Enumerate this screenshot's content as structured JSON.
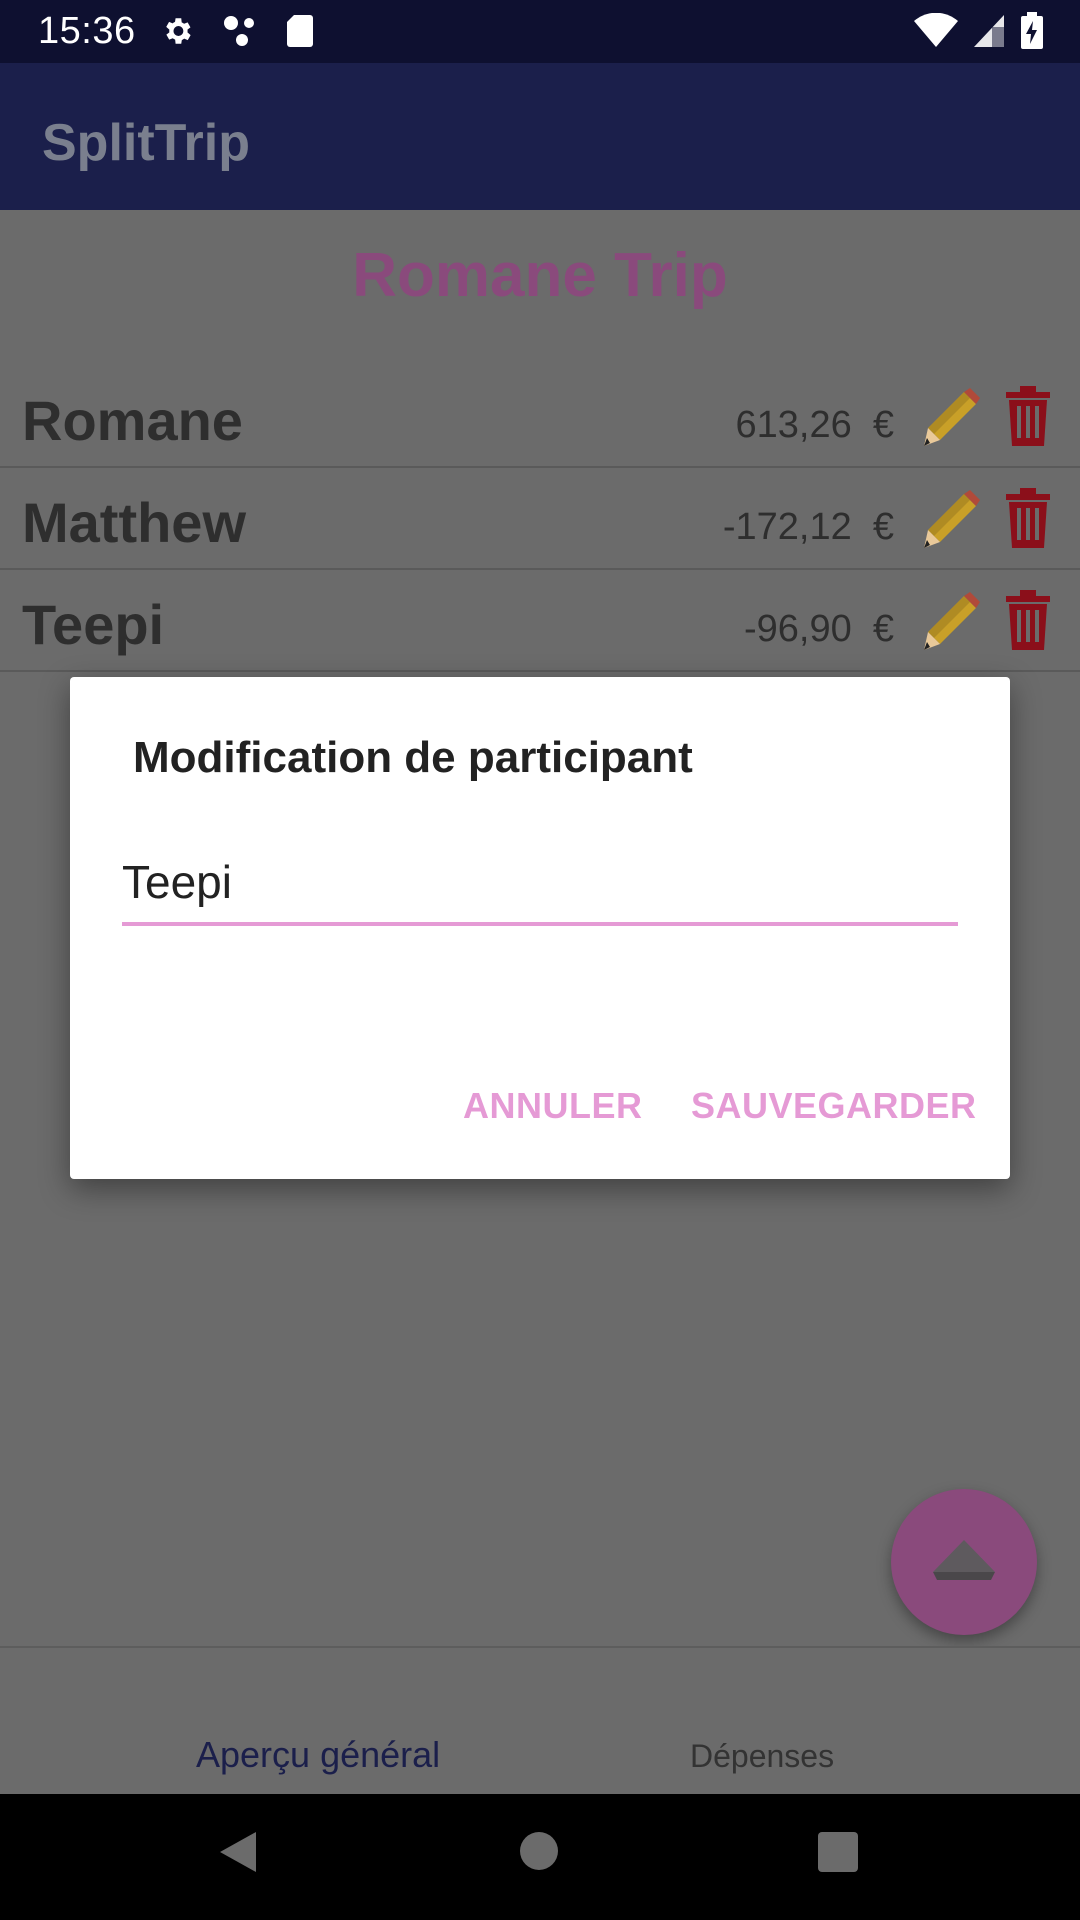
{
  "status": {
    "time": "15:36"
  },
  "app": {
    "title": "SplitTrip"
  },
  "trip": {
    "title": "Romane Trip"
  },
  "participants": [
    {
      "name": "Romane",
      "amount": "613,26",
      "currency": "€"
    },
    {
      "name": "Matthew",
      "amount": "-172,12",
      "currency": "€"
    },
    {
      "name": "Teepi",
      "amount": "-96,90",
      "currency": "€"
    }
  ],
  "dialog": {
    "title": "Modification de participant",
    "input_value": "Teepi",
    "cancel_label": "ANNULER",
    "save_label": "SAUVEGARDER"
  },
  "tabs": {
    "apercu": "Aperçu général",
    "depenses": "Dépenses"
  },
  "colors": {
    "accent": "#e59ad5",
    "appbar": "#1b1f4b",
    "delete": "#8b0f1a"
  }
}
